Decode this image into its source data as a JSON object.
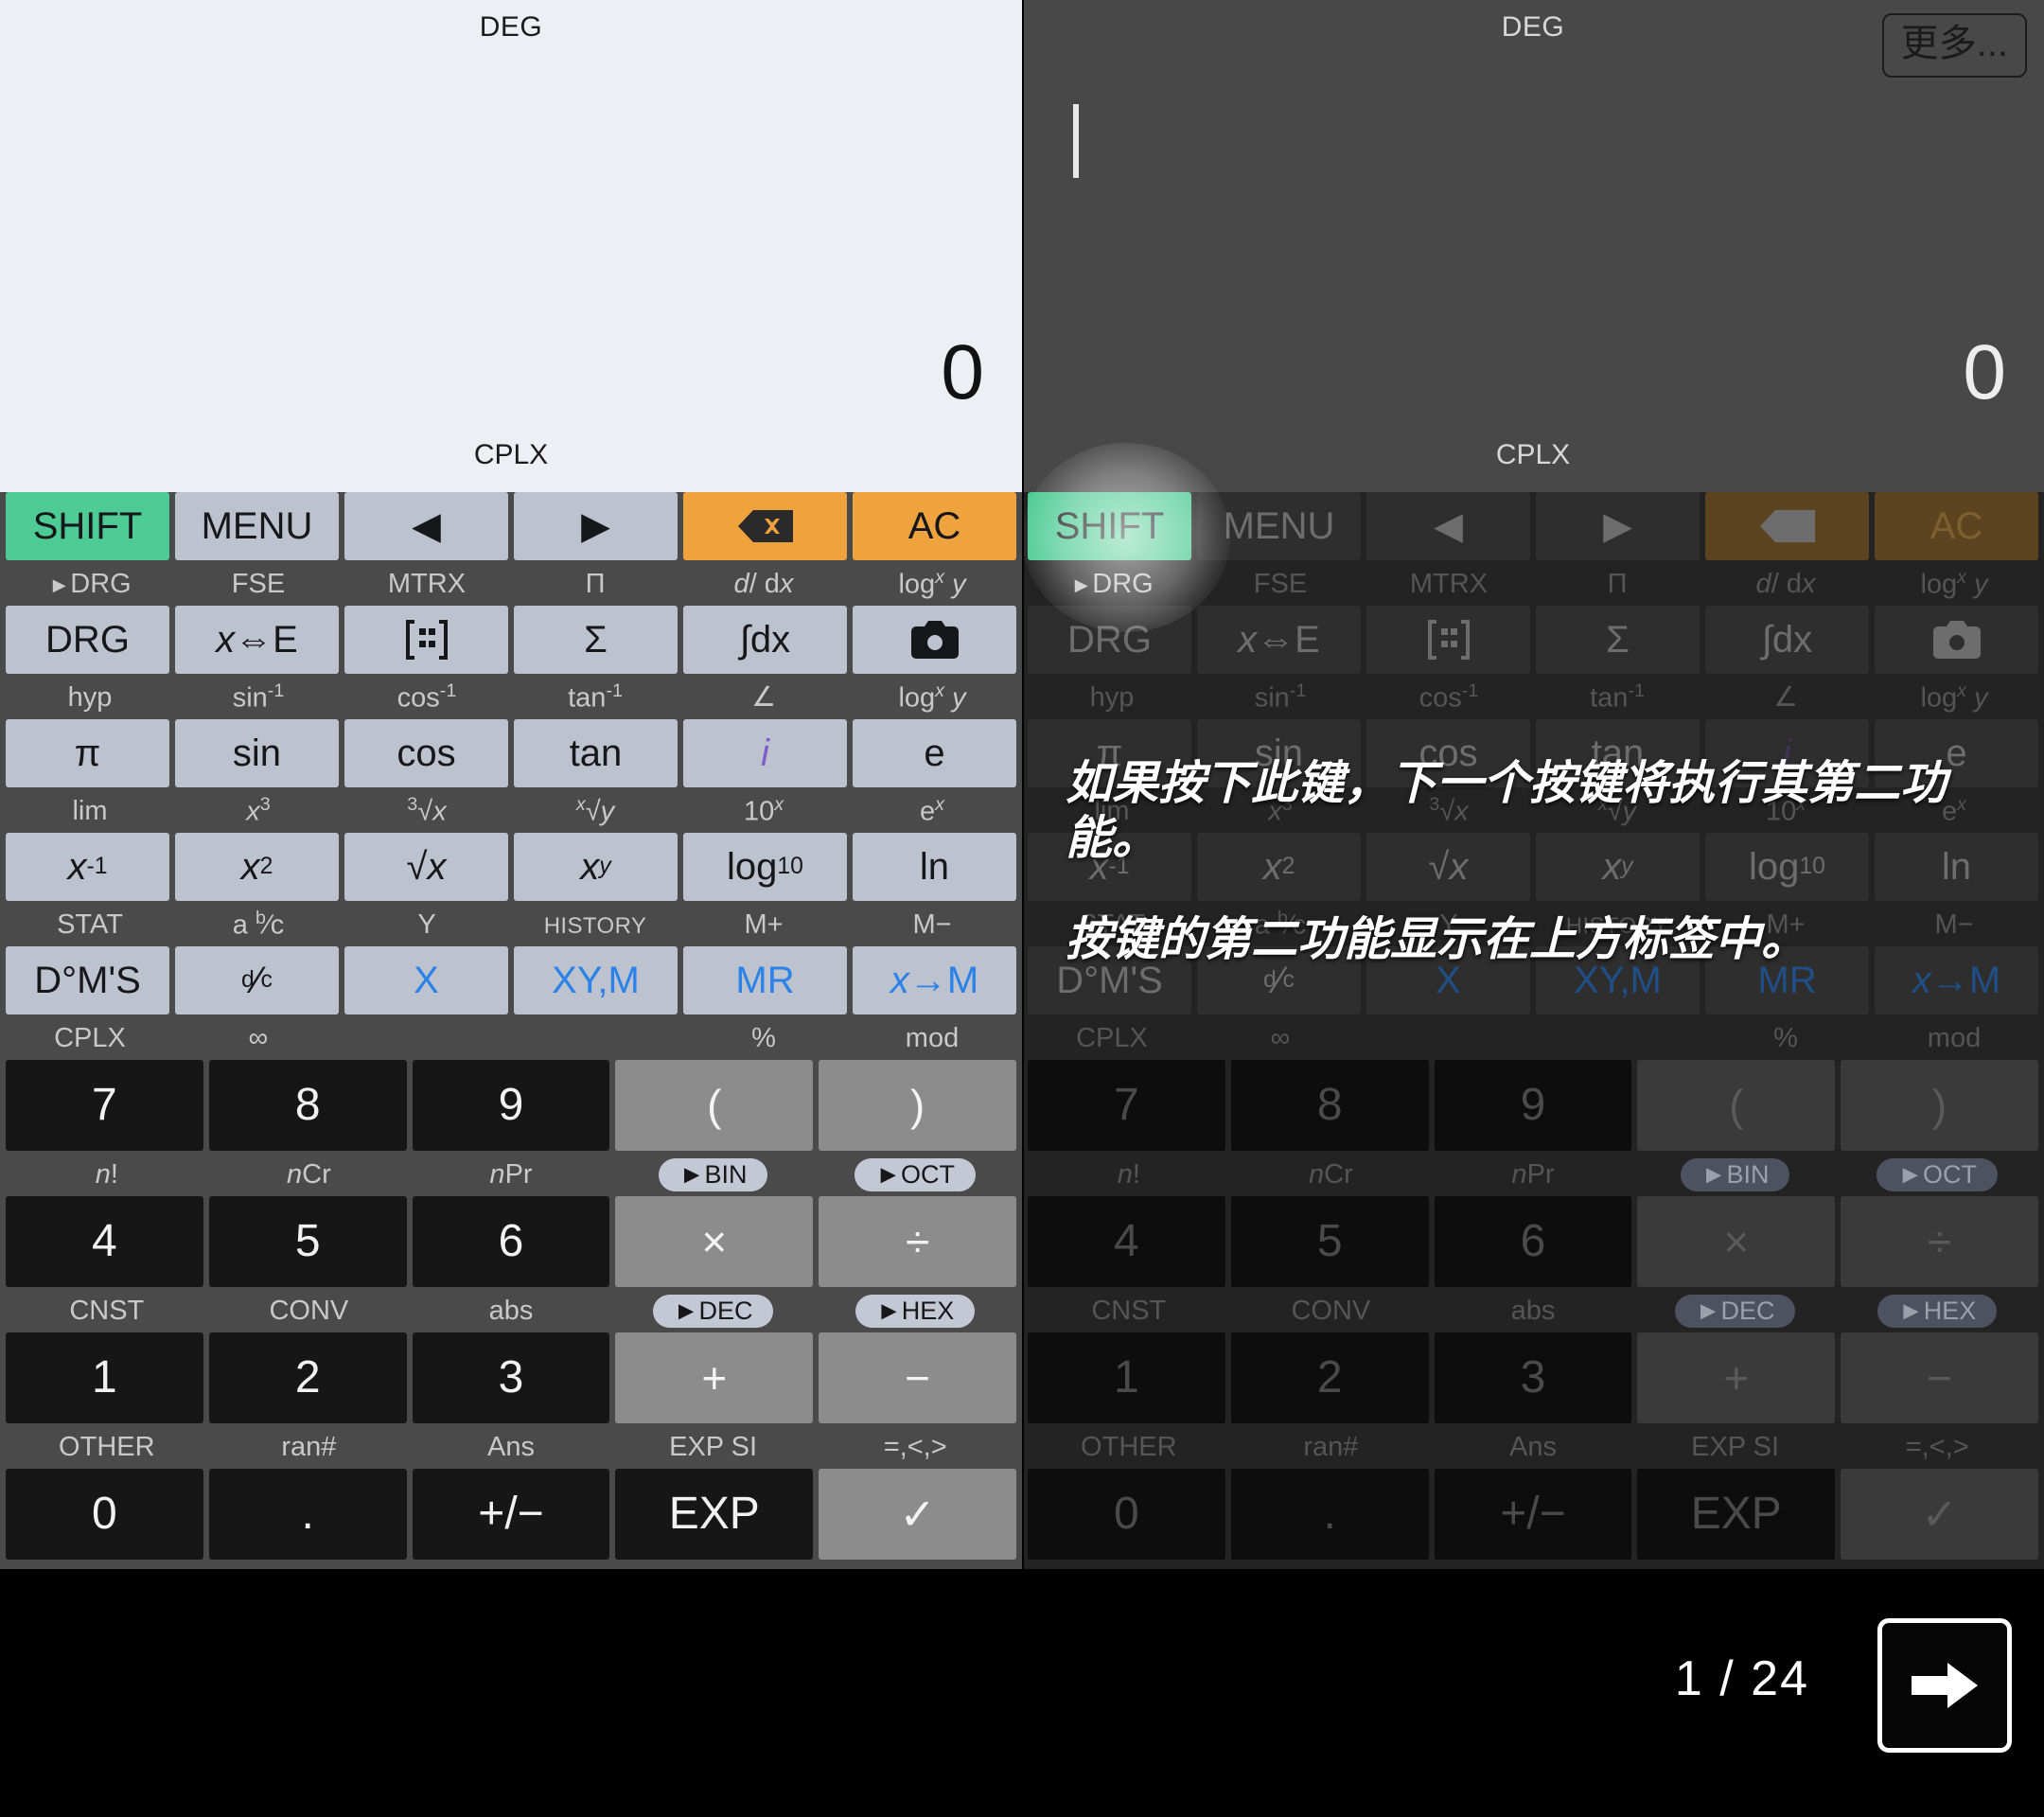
{
  "left_panel": {
    "angle_mode": "DEG",
    "result": "0",
    "status_indicator": "CPLX"
  },
  "right_panel": {
    "angle_mode": "DEG",
    "result": "0",
    "status_indicator": "CPLX",
    "more_button": "更多...",
    "tooltip_line1": "如果按下此键，下一个按键将执行其第二功能。",
    "tooltip_line2": "按键的第二功能显示在上方标签中。",
    "page_indicator": "1 / 24",
    "next_icon": "arrow-right-icon"
  },
  "keypad": {
    "rows": [
      {
        "secondary": [
          "►DRG",
          "FSE",
          "MTRX",
          "П",
          "d/ dx",
          "log<sub>x</sub> y"
        ],
        "keys": [
          {
            "label": "SHIFT",
            "style": "green"
          },
          {
            "label": "MENU",
            "style": "plain"
          },
          {
            "label": "◀",
            "style": "plain"
          },
          {
            "label": "▶",
            "style": "plain"
          },
          {
            "label": "backspace-icon",
            "style": "orange"
          },
          {
            "label": "AC",
            "style": "orange"
          }
        ]
      },
      {
        "secondary": [
          "hyp",
          "sin⁻¹",
          "cos⁻¹",
          "tan⁻¹",
          "∠",
          "log<sub>x</sub> y"
        ],
        "keys": [
          {
            "label": "DRG",
            "style": "plain"
          },
          {
            "label": "x⇔E",
            "style": "plain"
          },
          {
            "label": "matrix-icon",
            "style": "plain"
          },
          {
            "label": "Σ",
            "style": "plain"
          },
          {
            "label": "∫dx",
            "style": "plain"
          },
          {
            "label": "camera-icon",
            "style": "plain"
          }
        ]
      },
      {
        "secondary": [
          "lim",
          "x³",
          "³√x",
          "ˣ√y",
          "10ˣ",
          "eˣ"
        ],
        "keys": [
          {
            "label": "π",
            "style": "plain"
          },
          {
            "label": "sin",
            "style": "plain"
          },
          {
            "label": "cos",
            "style": "plain"
          },
          {
            "label": "tan",
            "style": "plain"
          },
          {
            "label": "i",
            "style": "purple"
          },
          {
            "label": "e",
            "style": "plain"
          }
        ]
      },
      {
        "secondary": [
          "STAT",
          "a b/c",
          "Y",
          "HISTORY",
          "M+",
          "M−"
        ],
        "keys": [
          {
            "label": "x⁻¹",
            "style": "plain"
          },
          {
            "label": "x²",
            "style": "plain"
          },
          {
            "label": "√x",
            "style": "plain"
          },
          {
            "label": "xʸ",
            "style": "plain"
          },
          {
            "label": "log₁₀",
            "style": "plain"
          },
          {
            "label": "ln",
            "style": "plain"
          }
        ]
      },
      {
        "secondary": [
          "CPLX",
          "∞",
          "",
          "",
          "%",
          "mod"
        ],
        "keys": [
          {
            "label": "D°M'S",
            "style": "plain"
          },
          {
            "label": "d/c",
            "style": "plain"
          },
          {
            "label": "X",
            "style": "blue"
          },
          {
            "label": "XY,M",
            "style": "blue"
          },
          {
            "label": "MR",
            "style": "blue"
          },
          {
            "label": "x→M",
            "style": "blue"
          }
        ]
      },
      {
        "secondary": [
          "n!",
          "nCr",
          "nPr",
          "►BIN",
          "►OCT"
        ],
        "keys": [
          {
            "label": "7",
            "style": "num"
          },
          {
            "label": "8",
            "style": "num"
          },
          {
            "label": "9",
            "style": "num"
          },
          {
            "label": "(",
            "style": "op"
          },
          {
            "label": ")",
            "style": "op"
          }
        ]
      },
      {
        "secondary": [
          "CNST",
          "CONV",
          "abs",
          "►DEC",
          "►HEX"
        ],
        "keys": [
          {
            "label": "4",
            "style": "num"
          },
          {
            "label": "5",
            "style": "num"
          },
          {
            "label": "6",
            "style": "num"
          },
          {
            "label": "×",
            "style": "op"
          },
          {
            "label": "÷",
            "style": "op"
          }
        ]
      },
      {
        "secondary": [
          "OTHER",
          "ran#",
          "Ans",
          "EXP SI",
          "=,<,>"
        ],
        "keys": [
          {
            "label": "1",
            "style": "num"
          },
          {
            "label": "2",
            "style": "num"
          },
          {
            "label": "3",
            "style": "num"
          },
          {
            "label": "+",
            "style": "op"
          },
          {
            "label": "−",
            "style": "op"
          }
        ]
      },
      {
        "secondary": [],
        "keys": [
          {
            "label": "0",
            "style": "num"
          },
          {
            "label": ".",
            "style": "num"
          },
          {
            "label": "+/−",
            "style": "num"
          },
          {
            "label": "EXP",
            "style": "num"
          },
          {
            "label": "✓",
            "style": "op"
          }
        ]
      }
    ]
  },
  "colors": {
    "shift_green": "#4ecb95",
    "orange": "#efa33f",
    "key_gray": "#bcc3ce",
    "keypad_bg": "#4a4a4a",
    "display_light": "#eceff3",
    "display_dark": "#484848",
    "memory_blue": "#2b82e8"
  }
}
